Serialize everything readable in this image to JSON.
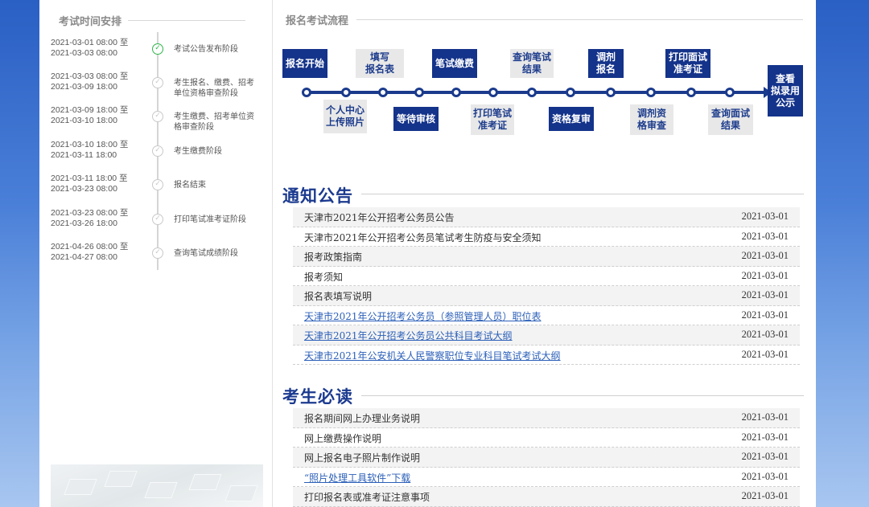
{
  "left": {
    "title": "考试时间安排",
    "timeline": [
      {
        "time": "2021-03-01 08:00 至\n2021-03-03 08:00",
        "label": "考试公告发布阶段",
        "status": "done"
      },
      {
        "time": "2021-03-03 08:00 至\n2021-03-09 18:00",
        "label": "考生报名、缴费、招考单位资格审查阶段",
        "status": "pending"
      },
      {
        "time": "2021-03-09 18:00 至\n2021-03-10 18:00",
        "label": "考生缴费、招考单位资格审查阶段",
        "status": "pending"
      },
      {
        "time": "2021-03-10 18:00 至\n2021-03-11 18:00",
        "label": "考生缴费阶段",
        "status": "pending"
      },
      {
        "time": "2021-03-11 18:00 至\n2021-03-23 08:00",
        "label": "报名结束",
        "status": "pending"
      },
      {
        "time": "2021-03-23 08:00 至\n2021-03-26 18:00",
        "label": "打印笔试准考证阶段",
        "status": "pending"
      },
      {
        "time": "2021-04-26 08:00 至\n2021-04-27 08:00",
        "label": "查询笔试成绩阶段",
        "status": "pending"
      }
    ]
  },
  "flow": {
    "title": "报名考试流程",
    "steps": [
      {
        "label": "报名开始",
        "style": "dark"
      },
      {
        "label": "个人中心\n上传照片",
        "style": "light"
      },
      {
        "label": "填写\n报名表",
        "style": "light"
      },
      {
        "label": "等待审核",
        "style": "dark"
      },
      {
        "label": "笔试缴费",
        "style": "dark"
      },
      {
        "label": "打印笔试\n准考证",
        "style": "light"
      },
      {
        "label": "查询笔试\n结果",
        "style": "light"
      },
      {
        "label": "资格复审",
        "style": "dark"
      },
      {
        "label": "调剂\n报名",
        "style": "dark"
      },
      {
        "label": "调剂资\n格审查",
        "style": "light"
      },
      {
        "label": "打印面试\n准考证",
        "style": "dark"
      },
      {
        "label": "查询面试\n结果",
        "style": "light"
      },
      {
        "label": "查看\n拟录用\n公示",
        "style": "dark"
      }
    ]
  },
  "notices": {
    "title": "通知公告",
    "items": [
      {
        "title": "天津市2021年公开招考公务员公告",
        "date": "2021-03-01",
        "link": false
      },
      {
        "title": "天津市2021年公开招考公务员笔试考生防疫与安全须知",
        "date": "2021-03-01",
        "link": false
      },
      {
        "title": "报考政策指南",
        "date": "2021-03-01",
        "link": false
      },
      {
        "title": "报考须知",
        "date": "2021-03-01",
        "link": false
      },
      {
        "title": "报名表填写说明",
        "date": "2021-03-01",
        "link": false
      },
      {
        "title": "天津市2021年公开招考公务员（参照管理人员）职位表",
        "date": "2021-03-01",
        "link": true
      },
      {
        "title": "天津市2021年公开招考公务员公共科目考试大纲",
        "date": "2021-03-01",
        "link": true
      },
      {
        "title": "天津市2021年公安机关人民警察职位专业科目笔试考试大纲",
        "date": "2021-03-01",
        "link": true
      }
    ]
  },
  "guide": {
    "title": "考生必读",
    "items": [
      {
        "title": "报名期间网上办理业务说明",
        "date": "2021-03-01",
        "link": false
      },
      {
        "title": "网上缴费操作说明",
        "date": "2021-03-01",
        "link": false
      },
      {
        "title": "网上报名电子照片制作说明",
        "date": "2021-03-01",
        "link": false
      },
      {
        "title": "“照片处理工具软件”下载",
        "date": "2021-03-01",
        "link": true
      },
      {
        "title": "打印报名表或准考证注意事项",
        "date": "2021-03-01",
        "link": false
      }
    ]
  },
  "colors": {
    "brand": "#14338a",
    "link": "#2b5fb8",
    "done": "#2fb54a"
  }
}
